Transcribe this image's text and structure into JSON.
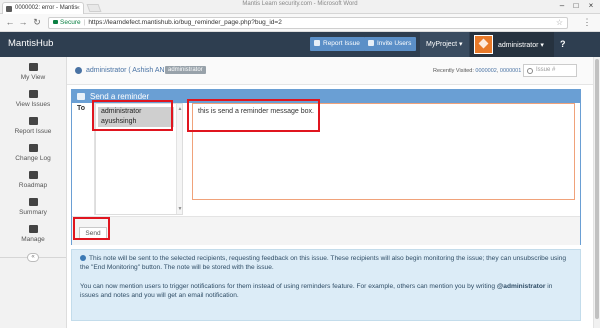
{
  "browser": {
    "tab_title": "0000002: error - Mantis",
    "window_title": "Mantis Learn security.com - Microsoft Word",
    "secure_label": "Secure",
    "url": "https://learndefect.mantishub.io/bug_reminder_page.php?bug_id=2",
    "tab_close": "×",
    "win_minimize": "–",
    "win_maximize": "□",
    "win_close": "×",
    "nav_back": "←",
    "nav_forward": "→",
    "nav_reload": "↻",
    "menu": "⋮",
    "star": "☆"
  },
  "navbar": {
    "brand": "MantisHub",
    "report_issue": "Report Issue",
    "invite_users": "Invite Users",
    "project": "MyProject ▾",
    "username": "administrator ▾",
    "help": "?"
  },
  "sidebar": {
    "items": [
      {
        "label": "My View",
        "icon": "dashboard-icon"
      },
      {
        "label": "View Issues",
        "icon": "list-icon"
      },
      {
        "label": "Report Issue",
        "icon": "edit-icon"
      },
      {
        "label": "Change Log",
        "icon": "retweet-icon"
      },
      {
        "label": "Roadmap",
        "icon": "road-icon"
      },
      {
        "label": "Summary",
        "icon": "bar-chart-icon"
      },
      {
        "label": "Manage",
        "icon": "gears-icon"
      }
    ],
    "collapse": "«"
  },
  "breadcrumb": {
    "user_link": "administrator ( Ashish AN )",
    "role_badge": "administrator",
    "recent_label": "Recently Visited:",
    "recent_1": "0000002",
    "recent_2": "0000001",
    "issue_placeholder": "Issue #"
  },
  "reminder": {
    "title": "Send a reminder",
    "to_label": "To",
    "recipients": [
      "administrator",
      "ayushsingh"
    ],
    "message": "this is send a reminder message box.",
    "send_label": "Send"
  },
  "info": {
    "paragraph_1": "This note will be sent to the selected recipients, requesting feedback on this issue. These recipients will also begin monitoring the issue; they can unsubscribe using the \"End Monitoring\" button. The note will be stored with the issue.",
    "paragraph_2_a": "You can now mention users to trigger notifications for them instead of using reminders feature. For example, others can mention you by writing ",
    "paragraph_2_mention": "@administrator",
    "paragraph_2_b": " in issues and notes and you will get an email notification."
  },
  "colors": {
    "navbar_bg": "#2e3e50",
    "panel_header": "#6a9fd4",
    "highlight": "#e0151f",
    "info_bg": "#dcecf7"
  }
}
